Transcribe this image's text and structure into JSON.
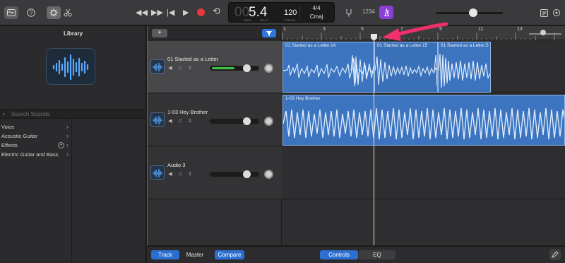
{
  "toolbar": {
    "buttons": [
      {
        "name": "library-button",
        "icon": "library-icon"
      },
      {
        "name": "help-button",
        "icon": "question-mark-icon"
      },
      {
        "name": "smart-controls-button",
        "icon": "knob-icon"
      },
      {
        "name": "editor-button",
        "icon": "scissors-icon"
      }
    ],
    "transport": {
      "rewind": "◀◀",
      "fast_forward": "▶▶",
      "go_to_start": "|◀",
      "play": "▶",
      "record_color": "#e5393b",
      "cycle": "⟲"
    },
    "lcd": {
      "bars": "00",
      "time": "5.4",
      "bar_label": "BAR",
      "beat_label": "BEAT",
      "tempo": "120",
      "tempo_label": "TEMPO",
      "time_signature": "4/4",
      "key": "Cmaj"
    },
    "count_in": "1234",
    "metronome_color": "#8a3fd6"
  },
  "library": {
    "title": "Library",
    "search_placeholder": "Search Sounds",
    "items": [
      {
        "label": "Voice",
        "has_plus": false
      },
      {
        "label": "Acoustic Guitar",
        "has_plus": false
      },
      {
        "label": "Effects",
        "has_plus": true
      },
      {
        "label": "Electric Guitar and Bass",
        "has_plus": false
      }
    ]
  },
  "tracks": [
    {
      "name": "01 Started as a Letter",
      "selected": true,
      "meter_level": 0.5,
      "volume": 0.72
    },
    {
      "name": "1-03 Hey Brother",
      "selected": false,
      "meter_level": 0,
      "volume": 0.72
    },
    {
      "name": "Audio 3",
      "selected": false,
      "meter_level": 0,
      "volume": 0.72
    }
  ],
  "ruler": {
    "labels": [
      "1",
      "3",
      "5",
      "7",
      "9",
      "11",
      "13"
    ],
    "playhead_bar": 5.4
  },
  "regions": [
    {
      "track": 0,
      "name": "01 Started as a Letter.14"
    },
    {
      "track": 0,
      "name": "01 Started as a Letter.15"
    },
    {
      "track": 0,
      "name": "01 Started as a Letter.5"
    },
    {
      "track": 1,
      "name": "1-03 Hey Brother"
    }
  ],
  "bottombar": {
    "track_label": "Track",
    "master_label": "Master",
    "compare_label": "Compare",
    "controls_label": "Controls",
    "eq_label": "EQ"
  },
  "colors": {
    "accent": "#2d6fd0",
    "region": "#3c74bf",
    "annotation_arrow": "#f0306a"
  }
}
